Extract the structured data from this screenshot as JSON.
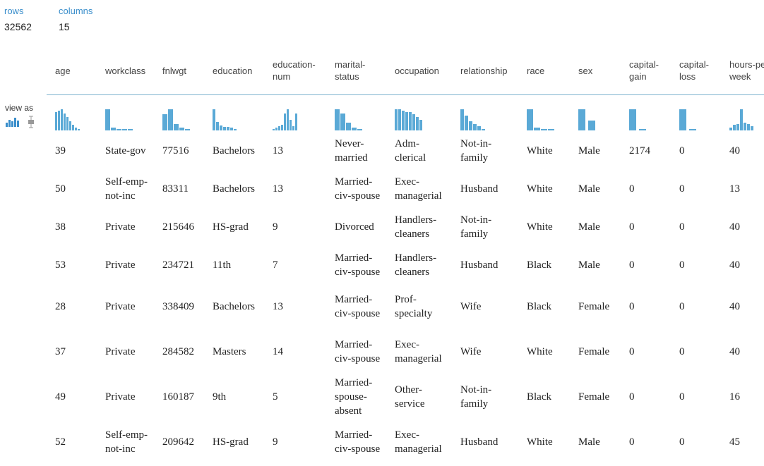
{
  "stats": {
    "rows_label": "rows",
    "rows_value": "32562",
    "columns_label": "columns",
    "columns_value": "15"
  },
  "view_as": {
    "label": "view as",
    "options": [
      "histogram-icon",
      "boxplot-icon"
    ],
    "active": "histogram-icon"
  },
  "accent_color": "#5aa9d6",
  "headers": [
    "age",
    "workclass",
    "fnlwgt",
    "education",
    "education-num",
    "marital-status",
    "occupation",
    "relationship",
    "race",
    "sex",
    "capital-gain",
    "capital-loss",
    "hours-per-week"
  ],
  "histograms": [
    [
      14,
      15,
      16,
      13,
      10,
      7,
      4,
      2,
      1
    ],
    [
      16,
      2,
      1,
      1,
      1
    ],
    [
      12,
      16,
      5,
      2,
      1
    ],
    [
      17,
      7,
      4,
      3,
      3,
      2,
      1
    ],
    [
      1,
      2,
      3,
      4,
      13,
      16,
      8,
      3,
      13
    ],
    [
      14,
      11,
      5,
      2,
      1
    ],
    [
      16,
      16,
      15,
      14,
      14,
      12,
      10,
      8
    ],
    [
      16,
      11,
      7,
      5,
      3,
      1
    ],
    [
      16,
      2,
      1,
      1
    ],
    [
      17,
      8
    ],
    [
      16,
      1
    ],
    [
      16,
      1
    ],
    [
      2,
      4,
      5,
      16,
      6,
      5,
      3
    ]
  ],
  "rows": [
    [
      "39",
      "State-gov",
      "77516",
      "Bachelors",
      "13",
      "Never-married",
      "Adm-clerical",
      "Not-in-family",
      "White",
      "Male",
      "2174",
      "0",
      "40"
    ],
    [
      "50",
      "Self-emp-not-inc",
      "83311",
      "Bachelors",
      "13",
      "Married-civ-spouse",
      "Exec-managerial",
      "Husband",
      "White",
      "Male",
      "0",
      "0",
      "13"
    ],
    [
      "38",
      "Private",
      "215646",
      "HS-grad",
      "9",
      "Divorced",
      "Handlers-cleaners",
      "Not-in-family",
      "White",
      "Male",
      "0",
      "0",
      "40"
    ],
    [
      "53",
      "Private",
      "234721",
      "11th",
      "7",
      "Married-civ-spouse",
      "Handlers-cleaners",
      "Husband",
      "Black",
      "Male",
      "0",
      "0",
      "40"
    ],
    [
      "28",
      "Private",
      "338409",
      "Bachelors",
      "13",
      "Married-civ-spouse",
      "Prof-specialty",
      "Wife",
      "Black",
      "Female",
      "0",
      "0",
      "40"
    ],
    [
      "37",
      "Private",
      "284582",
      "Masters",
      "14",
      "Married-civ-spouse",
      "Exec-managerial",
      "Wife",
      "White",
      "Female",
      "0",
      "0",
      "40"
    ],
    [
      "49",
      "Private",
      "160187",
      "9th",
      "5",
      "Married-spouse-absent",
      "Other-service",
      "Not-in-family",
      "Black",
      "Female",
      "0",
      "0",
      "16"
    ],
    [
      "52",
      "Self-emp-not-inc",
      "209642",
      "HS-grad",
      "9",
      "Married-civ-spouse",
      "Exec-managerial",
      "Husband",
      "White",
      "Male",
      "0",
      "0",
      "45"
    ]
  ]
}
